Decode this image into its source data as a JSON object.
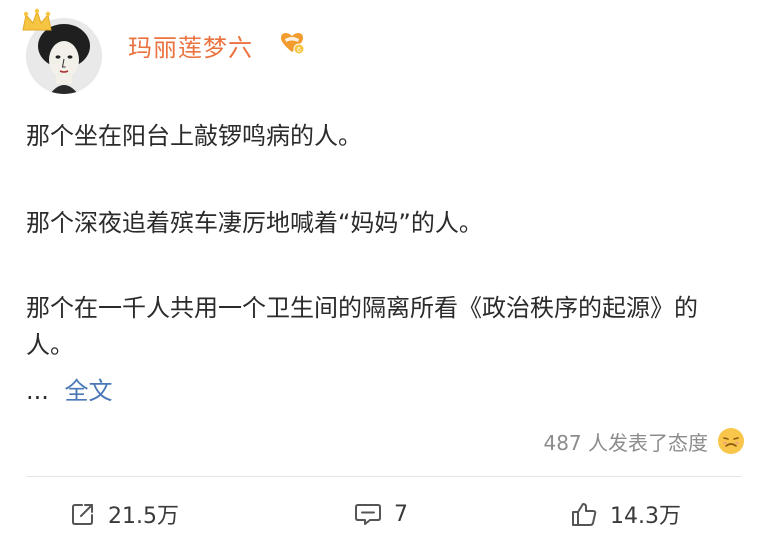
{
  "post": {
    "author": {
      "name": "玛丽莲梦六"
    },
    "paragraphs": [
      "那个坐在阳台上敲锣鸣病的人。",
      "那个深夜追着殡车凄厉地喊着“妈妈”的人。",
      "那个在一千人共用一个卫生间的隔离所看《政治秩序的起源》的人。"
    ],
    "ellipsis": "...",
    "expand_label": "全文",
    "reactions_text": "487 人发表了态度"
  },
  "actions": {
    "repost_count": "21.5万",
    "comment_count": "7",
    "like_count": "14.3万"
  },
  "icons": {
    "crown": "crown-icon",
    "badge": "vip-badge-icon",
    "reaction_emoji": "sad-emoji-icon",
    "repost": "repost-icon",
    "comment": "comment-icon",
    "like": "thumbs-up-icon"
  },
  "colors": {
    "username": "#eb7340",
    "link": "#4a78b8",
    "muted": "#8c8c8c",
    "text": "#2b2b2b"
  }
}
